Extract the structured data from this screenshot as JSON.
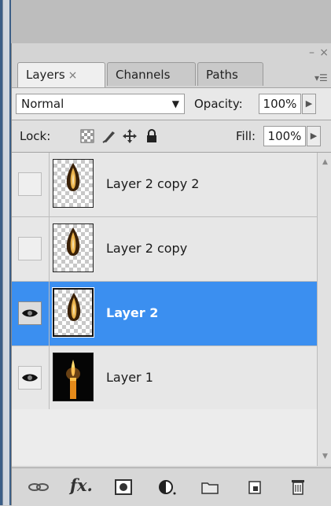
{
  "panel": {
    "tabs": [
      {
        "label": "Layers",
        "close": "×",
        "active": true
      },
      {
        "label": "Channels",
        "active": false
      },
      {
        "label": "Paths",
        "active": false
      }
    ],
    "controls": {
      "minimize": "–",
      "close": "×",
      "menu": "▾☰"
    }
  },
  "blend": {
    "mode": "Normal",
    "opacity_label": "Opacity:",
    "opacity_value": "100%"
  },
  "lock": {
    "label": "Lock:",
    "fill_label": "Fill:",
    "fill_value": "100%"
  },
  "layers": [
    {
      "name": "Layer 2 copy 2",
      "visible": false,
      "selected": false,
      "thumb": "flame"
    },
    {
      "name": "Layer 2 copy",
      "visible": false,
      "selected": false,
      "thumb": "flame"
    },
    {
      "name": "Layer 2",
      "visible": true,
      "selected": true,
      "thumb": "flame"
    },
    {
      "name": "Layer 1",
      "visible": true,
      "selected": false,
      "thumb": "candle"
    }
  ],
  "bottom_icons": [
    "link-icon",
    "fx-icon",
    "mask-icon",
    "adjustment-icon",
    "folder-icon",
    "new-layer-icon",
    "trash-icon"
  ],
  "colors": {
    "selected_row": "#3b8ff0",
    "panel_bg": "#d4d4d4"
  }
}
